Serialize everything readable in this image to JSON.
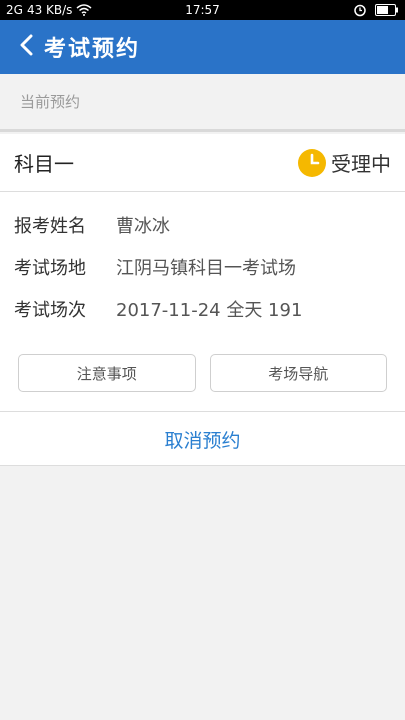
{
  "status_bar": {
    "network": "2G",
    "speed": "43 KB/s",
    "time": "17:57",
    "icons": [
      "wifi-icon",
      "alarm-icon",
      "battery-icon"
    ]
  },
  "header": {
    "back_icon": "chevron-left-icon",
    "title": "考试预约"
  },
  "section": {
    "label": "当前预约"
  },
  "booking": {
    "subject": "科目一",
    "status_icon": "clock-icon",
    "status": "受理中",
    "fields": [
      {
        "key": "报考姓名",
        "value": "曹冰冰"
      },
      {
        "key": "考试场地",
        "value": "江阴马镇科目一考试场"
      },
      {
        "key": "考试场次",
        "value": "2017-11-24 全天 191"
      }
    ],
    "buttons": {
      "notice": "注意事项",
      "navigation": "考场导航"
    },
    "cancel": "取消预约"
  },
  "colors": {
    "primary": "#2a73c8",
    "link": "#2a7fd0",
    "status_icon": "#f5b800",
    "background": "#f2f2f2"
  }
}
